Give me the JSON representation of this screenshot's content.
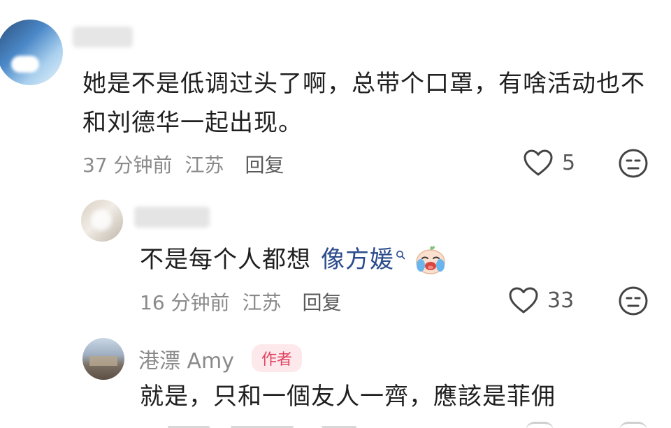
{
  "comments": [
    {
      "text_line1": "她是不是低调过头了啊，总带个口罩，有啥活动也不",
      "text_line2": "和刘德华一起出现。",
      "time": "37 分钟前",
      "location": "江苏",
      "reply_label": "回复",
      "likes": "5"
    },
    {
      "text_prefix": "不是每个人都想",
      "mention": "像方媛",
      "time": "16 分钟前",
      "location": "江苏",
      "reply_label": "回复",
      "likes": "33"
    },
    {
      "username": "港漂 Amy",
      "badge": "作者",
      "text": "就是，只和一個友人一齊，應該是菲佣"
    }
  ],
  "colors": {
    "text": "#1f1f1f",
    "meta": "#8a8a8a",
    "mention": "#2b4b8c",
    "author_badge": "#e0435f"
  },
  "icons": [
    "heart-outline-icon",
    "dislike-face-icon",
    "search-icon",
    "crying-emoji-icon"
  ]
}
